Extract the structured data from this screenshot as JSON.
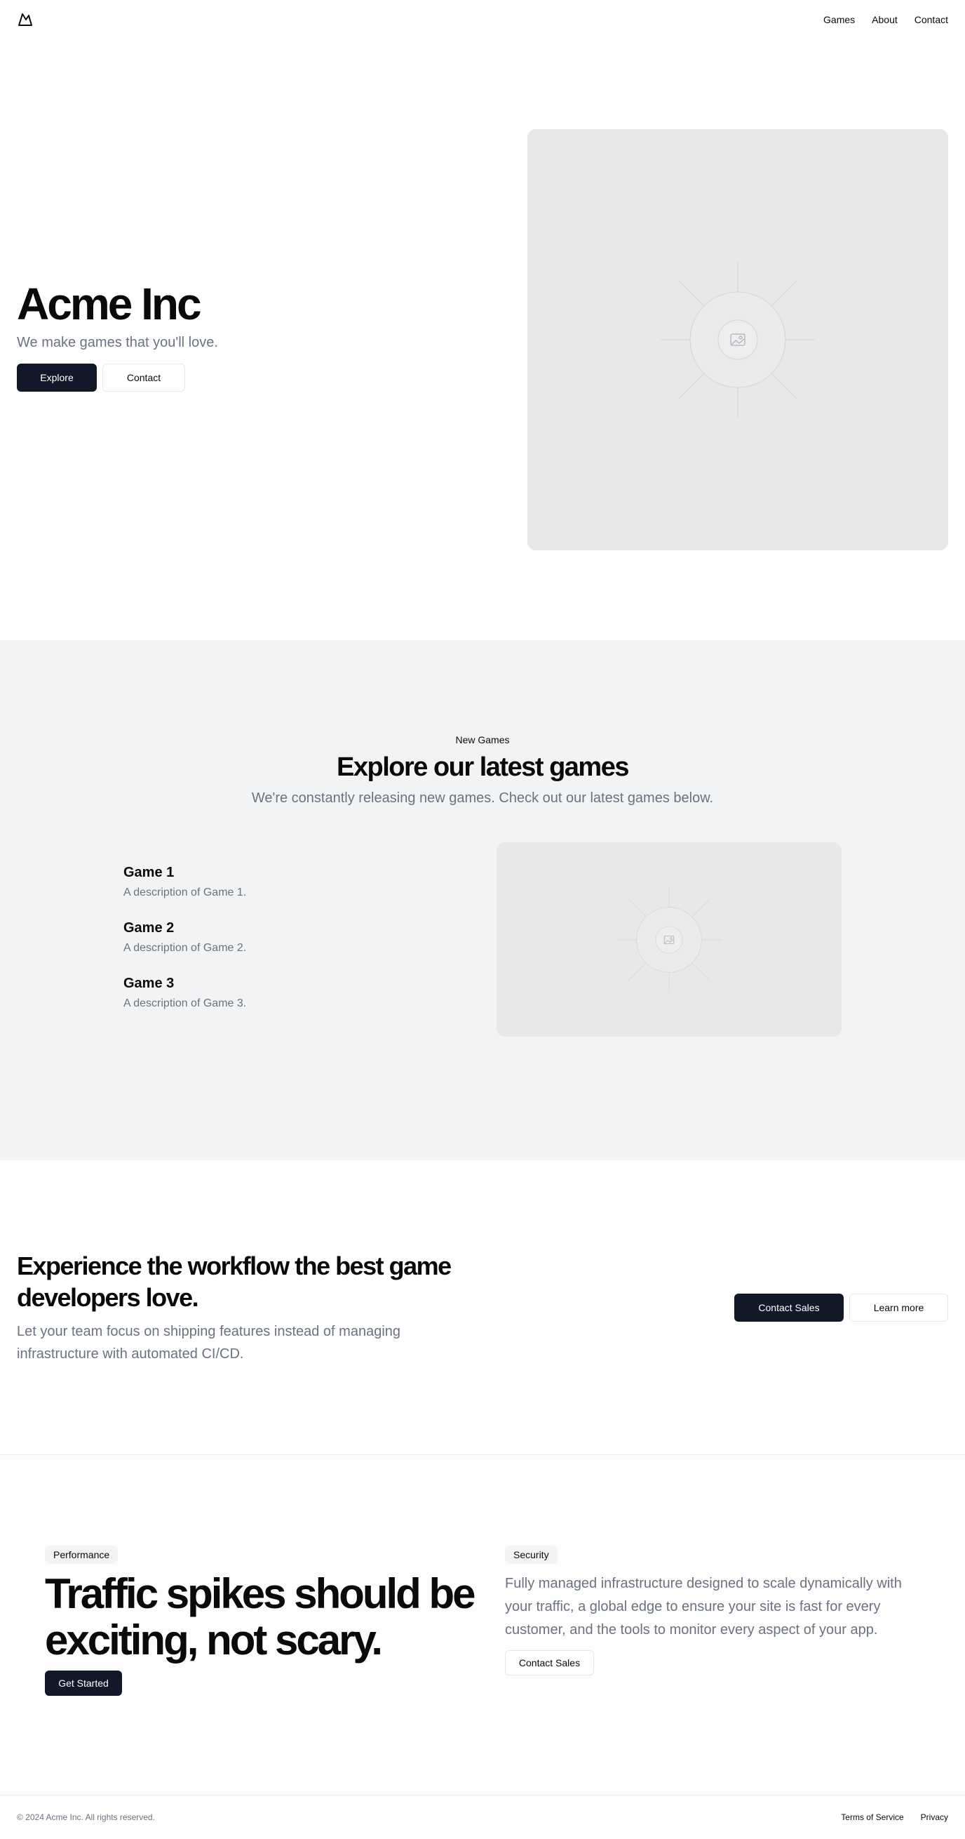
{
  "nav": {
    "logo_icon": "mountain-logo-icon",
    "items": [
      {
        "label": "Games"
      },
      {
        "label": "About"
      },
      {
        "label": "Contact"
      }
    ]
  },
  "hero": {
    "title": "Acme Inc",
    "subtitle": "We make games that you'll love.",
    "primary_button": "Explore",
    "secondary_button": "Contact",
    "image_icon": "image-placeholder-icon"
  },
  "games_section": {
    "eyebrow": "New Games",
    "title": "Explore our latest games",
    "subtitle": "We're constantly releasing new games. Check out our latest games below.",
    "games": [
      {
        "name": "Game 1",
        "description": "A description of Game 1."
      },
      {
        "name": "Game 2",
        "description": "A description of Game 2."
      },
      {
        "name": "Game 3",
        "description": "A description of Game 3."
      }
    ],
    "image_icon": "image-placeholder-icon"
  },
  "cta": {
    "title": "Experience the workflow the best game developers love.",
    "subtitle": "Let your team focus on shipping features instead of managing infrastructure with automated CI/CD.",
    "primary_button": "Contact Sales",
    "secondary_button": "Learn more"
  },
  "features": {
    "performance": {
      "badge": "Performance",
      "title": "Traffic spikes should be exciting, not scary.",
      "button": "Get Started"
    },
    "security": {
      "badge": "Security",
      "text": "Fully managed infrastructure designed to scale dynamically with your traffic, a global edge to ensure your site is fast for every customer, and the tools to monitor every aspect of your app.",
      "button": "Contact Sales"
    }
  },
  "footer": {
    "copyright": "© 2024 Acme Inc. All rights reserved.",
    "links": [
      {
        "label": "Terms of Service"
      },
      {
        "label": "Privacy"
      }
    ]
  },
  "colors": {
    "primary": "#111827",
    "muted_text": "#6b7280",
    "section_bg": "#f2f3f5",
    "placeholder_bg": "#e8e8e8"
  }
}
